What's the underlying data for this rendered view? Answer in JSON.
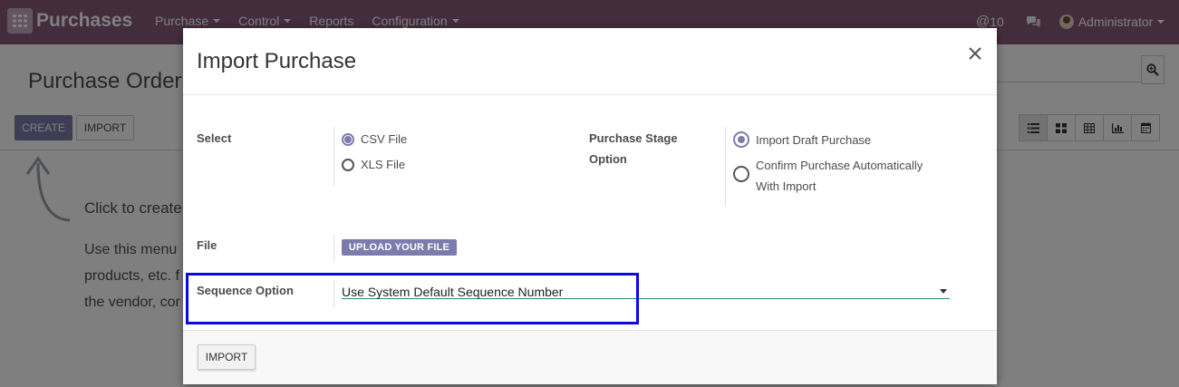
{
  "navbar": {
    "app_name": "Purchases",
    "menu": [
      "Purchase",
      "Control",
      "Reports",
      "Configuration"
    ],
    "activity_count": "10",
    "user_name": "Administrator",
    "background_color": "#875a7b"
  },
  "control_panel": {
    "breadcrumb_title": "Purchase Order",
    "create_label": "CREATE",
    "import_label": "IMPORT",
    "search_placeholder": "",
    "views": [
      "list-view-icon",
      "kanban-view-icon",
      "pivot-view-icon",
      "graph-view-icon",
      "calendar-view-icon"
    ]
  },
  "help": {
    "title": "Click to create",
    "lines": [
      "Use this menu",
      "products, etc. f",
      "the vendor, cor"
    ]
  },
  "modal": {
    "title": "Import Purchase",
    "select_label": "Select",
    "select_options": [
      {
        "label": "CSV File",
        "checked": true
      },
      {
        "label": "XLS File",
        "checked": false
      }
    ],
    "stage_label_line1": "Purchase Stage",
    "stage_label_line2": "Option",
    "stage_options": [
      {
        "label": "Import Draft Purchase",
        "checked": true
      },
      {
        "label_line1": "Confirm Purchase Automatically",
        "label_line2": "With Import",
        "checked": false
      }
    ],
    "file_label": "File",
    "upload_label": "UPLOAD YOUR FILE",
    "sequence_label": "Sequence Option",
    "sequence_value": "Use System Default Sequence Number",
    "import_button": "IMPORT",
    "accent_color": "#7c7bad",
    "highlight_color": "#0b09e0"
  }
}
